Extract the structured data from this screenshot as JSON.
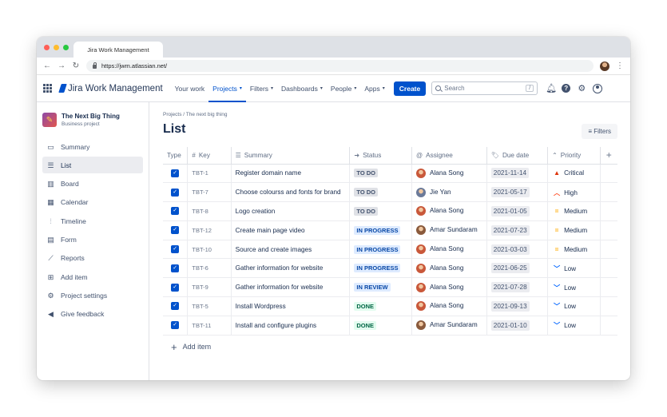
{
  "browser": {
    "tab_title": "Jira Work Management",
    "url": "https://jwm.atlassian.net/",
    "traffic_colors": [
      "#ff5f57",
      "#febc2e",
      "#28c840"
    ]
  },
  "header": {
    "logo_text": "Jira Work Management",
    "nav": [
      {
        "label": "Your work",
        "dropdown": false,
        "active": false
      },
      {
        "label": "Projects",
        "dropdown": true,
        "active": true
      },
      {
        "label": "Filters",
        "dropdown": true,
        "active": false
      },
      {
        "label": "Dashboards",
        "dropdown": true,
        "active": false
      },
      {
        "label": "People",
        "dropdown": true,
        "active": false
      },
      {
        "label": "Apps",
        "dropdown": true,
        "active": false
      }
    ],
    "create_label": "Create",
    "search_placeholder": "Search",
    "search_shortcut": "/",
    "brand_color": "#0052cc"
  },
  "sidebar": {
    "project_name": "The Next Big Thing",
    "project_type": "Business project",
    "items": [
      {
        "label": "Summary",
        "icon": "summary-icon",
        "glyph": "▭",
        "active": false
      },
      {
        "label": "List",
        "icon": "list-icon",
        "glyph": "☰",
        "active": true
      },
      {
        "label": "Board",
        "icon": "board-icon",
        "glyph": "▥",
        "active": false
      },
      {
        "label": "Calendar",
        "icon": "calendar-icon",
        "glyph": "▦",
        "active": false
      },
      {
        "label": "Timeline",
        "icon": "timeline-icon",
        "glyph": "⫶",
        "active": false
      },
      {
        "label": "Form",
        "icon": "form-icon",
        "glyph": "▤",
        "active": false
      },
      {
        "label": "Reports",
        "icon": "reports-icon",
        "glyph": "⟋",
        "active": false
      },
      {
        "label": "Add item",
        "icon": "add-item-icon",
        "glyph": "⊞",
        "active": false
      },
      {
        "label": "Project settings",
        "icon": "gear-icon",
        "glyph": "⚙",
        "active": false
      },
      {
        "label": "Give feedback",
        "icon": "megaphone-icon",
        "glyph": "◀",
        "active": false
      }
    ]
  },
  "main": {
    "breadcrumb": "Projects / The next big thing",
    "title": "List",
    "filters_label": "Filters",
    "columns": [
      "Type",
      "Key",
      "Summary",
      "Status",
      "Assignee",
      "Due date",
      "Priority"
    ],
    "add_item_label": "Add item",
    "rows": [
      {
        "key": "TBT-1",
        "summary": "Register domain name",
        "status": "TO DO",
        "status_bg": "#dfe1e6",
        "status_fg": "#42526e",
        "assignee": "Alana Song",
        "avatar": "#c9583a",
        "due": "2021-11-14",
        "priority": "Critical",
        "pri_glyph": "▲",
        "pri_color": "#de350b"
      },
      {
        "key": "TBT-7",
        "summary": "Choose colourss and fonts for brand",
        "status": "TO DO",
        "status_bg": "#dfe1e6",
        "status_fg": "#42526e",
        "assignee": "Jie Yan",
        "avatar": "#6b7a99",
        "due": "2021-05-17",
        "priority": "High",
        "pri_glyph": "︿",
        "pri_color": "#ff5630"
      },
      {
        "key": "TBT-8",
        "summary": "Logo creation",
        "status": "TO DO",
        "status_bg": "#dfe1e6",
        "status_fg": "#42526e",
        "assignee": "Alana Song",
        "avatar": "#c9583a",
        "due": "2021-01-05",
        "priority": "Medium",
        "pri_glyph": "=",
        "pri_color": "#ffab00"
      },
      {
        "key": "TBT-12",
        "summary": "Create main page video",
        "status": "IN PROGRESS",
        "status_bg": "#deebff",
        "status_fg": "#0747a6",
        "assignee": "Amar Sundaram",
        "avatar": "#8a5a3c",
        "due": "2021-07-23",
        "priority": "Medium",
        "pri_glyph": "=",
        "pri_color": "#ffab00"
      },
      {
        "key": "TBT-10",
        "summary": "Source and create images",
        "status": "IN PROGRESS",
        "status_bg": "#deebff",
        "status_fg": "#0747a6",
        "assignee": "Alana Song",
        "avatar": "#c9583a",
        "due": "2021-03-03",
        "priority": "Medium",
        "pri_glyph": "=",
        "pri_color": "#ffab00"
      },
      {
        "key": "TBT-6",
        "summary": "Gather information for website",
        "status": "IN PROGRESS",
        "status_bg": "#deebff",
        "status_fg": "#0747a6",
        "assignee": "Alana Song",
        "avatar": "#c9583a",
        "due": "2021-06-25",
        "priority": "Low",
        "pri_glyph": "﹀",
        "pri_color": "#0065ff"
      },
      {
        "key": "TBT-9",
        "summary": "Gather information for website",
        "status": "IN REVIEW",
        "status_bg": "#deebff",
        "status_fg": "#0747a6",
        "assignee": "Alana Song",
        "avatar": "#c9583a",
        "due": "2021-07-28",
        "priority": "Low",
        "pri_glyph": "﹀",
        "pri_color": "#0065ff"
      },
      {
        "key": "TBT-5",
        "summary": "Install Wordpress",
        "status": "DONE",
        "status_bg": "#e3fcef",
        "status_fg": "#006644",
        "assignee": "Alana Song",
        "avatar": "#c9583a",
        "due": "2021-09-13",
        "priority": "Low",
        "pri_glyph": "﹀",
        "pri_color": "#0065ff"
      },
      {
        "key": "TBT-11",
        "summary": "Install and configure plugins",
        "status": "DONE",
        "status_bg": "#e3fcef",
        "status_fg": "#006644",
        "assignee": "Amar Sundaram",
        "avatar": "#8a5a3c",
        "due": "2021-01-10",
        "priority": "Low",
        "pri_glyph": "﹀",
        "pri_color": "#0065ff"
      }
    ]
  }
}
